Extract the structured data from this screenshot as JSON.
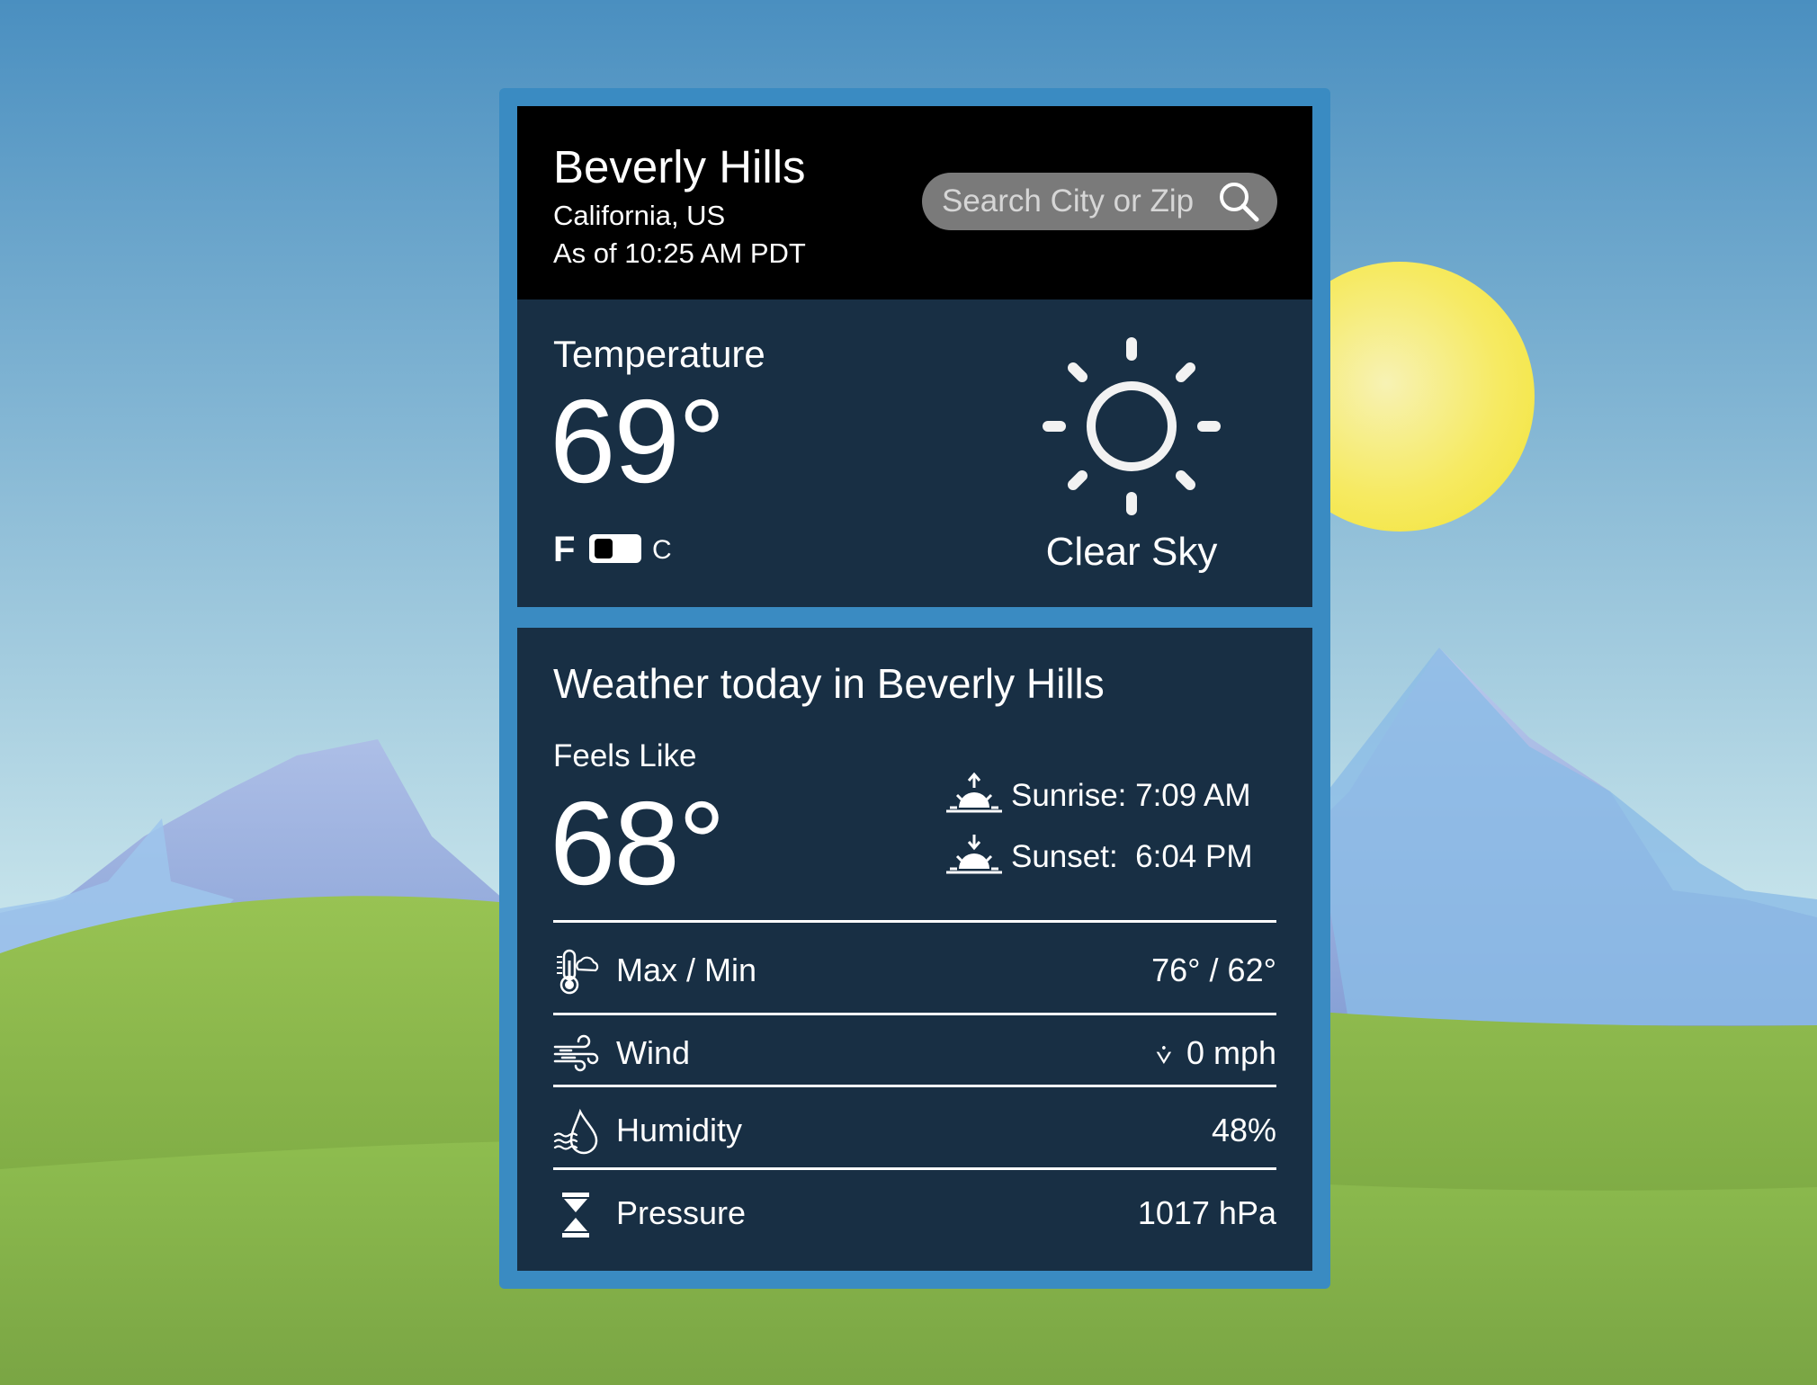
{
  "location": {
    "city": "Beverly Hills",
    "region": "California, US",
    "as_of": "As of 10:25 AM PDT"
  },
  "search": {
    "placeholder": "Search City or Zip",
    "value": ""
  },
  "current": {
    "label": "Temperature",
    "temperature": "69°",
    "unit_f": "F",
    "unit_c": "C",
    "selected_unit": "F",
    "condition": "Clear Sky",
    "icon": "sun-icon"
  },
  "today": {
    "title": "Weather today in Beverly Hills",
    "feels_like_label": "Feels Like",
    "feels_like_value": "68°",
    "sunrise": "Sunrise: 7:09 AM",
    "sunset": "Sunset:  6:04 PM",
    "stats": [
      {
        "icon": "thermometer-icon",
        "label": "Max / Min",
        "value": "76° / 62°"
      },
      {
        "icon": "wind-icon",
        "label": "Wind",
        "direction_glyph": "⩒",
        "value": "0 mph"
      },
      {
        "icon": "humidity-icon",
        "label": "Humidity",
        "value": "48%"
      },
      {
        "icon": "pressure-icon",
        "label": "Pressure",
        "value": "1017 hPa"
      }
    ]
  },
  "colors": {
    "sky_top": "#4a8fc0",
    "sky_bottom": "#c4e2ea",
    "widget_frame": "#3a8bc2",
    "header_bg": "#000000",
    "panel_bg": "#182f44",
    "sun": "#f7ea5e",
    "grass": "#8cbc4e"
  }
}
